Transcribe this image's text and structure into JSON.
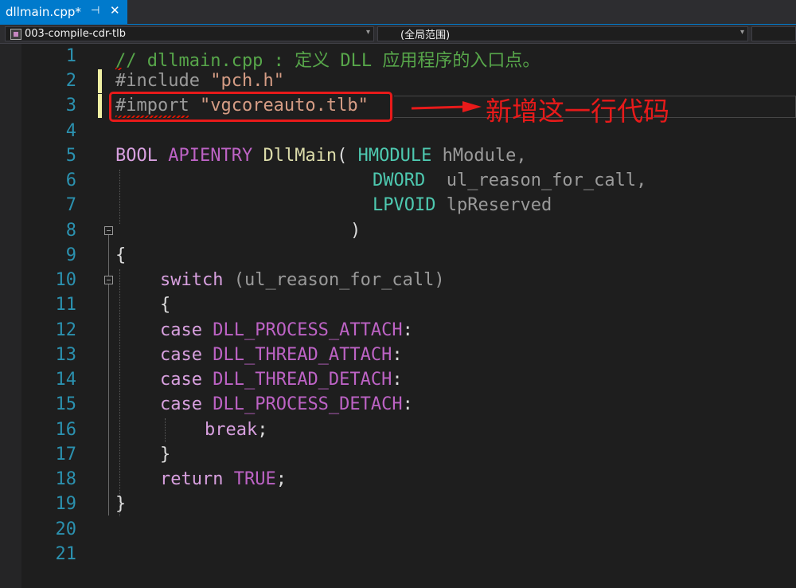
{
  "tab": {
    "title": "dllmain.cpp*",
    "pin_glyph": "⊣",
    "close_glyph": "✕"
  },
  "navbar": {
    "project": "003-compile-cdr-tlb",
    "scope": "(全局范围)"
  },
  "editor": {
    "line_numbers": [
      "1",
      "2",
      "3",
      "4",
      "5",
      "6",
      "7",
      "8",
      "9",
      "10",
      "11",
      "12",
      "13",
      "14",
      "15",
      "16",
      "17",
      "18",
      "19",
      "20",
      "21"
    ],
    "lines": {
      "l1": {
        "comment": "// dllmain.cpp : 定义 DLL 应用程序的入口点。"
      },
      "l2": {
        "directive": "#include",
        "path": "\"pch.h\""
      },
      "l3": {
        "directive": "#import",
        "path": "\"vgcoreauto.tlb\""
      },
      "l5": {
        "ret_type": "BOOL",
        "callconv": "APIENTRY",
        "fn": "DllMain",
        "open": "(",
        "p1_type": "HMODULE",
        "p1_name": "hModule,"
      },
      "l6": {
        "p2_type": "DWORD",
        "p2_name": "ul_reason_for_call,"
      },
      "l7": {
        "p3_type": "LPVOID",
        "p3_name": "lpReserved"
      },
      "l8": {
        "close": ")"
      },
      "l9": {
        "brace": "{"
      },
      "l10": {
        "kw": "switch",
        "rest": "(ul_reason_for_call)"
      },
      "l11": {
        "brace": "{"
      },
      "l12": {
        "kw": "case",
        "const": "DLL_PROCESS_ATTACH",
        "colon": ":"
      },
      "l13": {
        "kw": "case",
        "const": "DLL_THREAD_ATTACH",
        "colon": ":"
      },
      "l14": {
        "kw": "case",
        "const": "DLL_THREAD_DETACH",
        "colon": ":"
      },
      "l15": {
        "kw": "case",
        "const": "DLL_PROCESS_DETACH",
        "colon": ":"
      },
      "l16": {
        "kw": "break",
        "semi": ";"
      },
      "l17": {
        "brace": "}"
      },
      "l18": {
        "kw": "return",
        "const": "TRUE",
        "semi": ";"
      },
      "l19": {
        "brace": "}"
      }
    }
  },
  "annotation": {
    "note": "新增这一行代码",
    "color": "#e81a1a"
  },
  "colors": {
    "accent": "#007acc",
    "background": "#1e1e1e",
    "line_number": "#2b91af",
    "comment": "#57a64a",
    "keyword": "#d8a0df",
    "type": "#4ec9b0",
    "change_marker": "#efefa3"
  }
}
